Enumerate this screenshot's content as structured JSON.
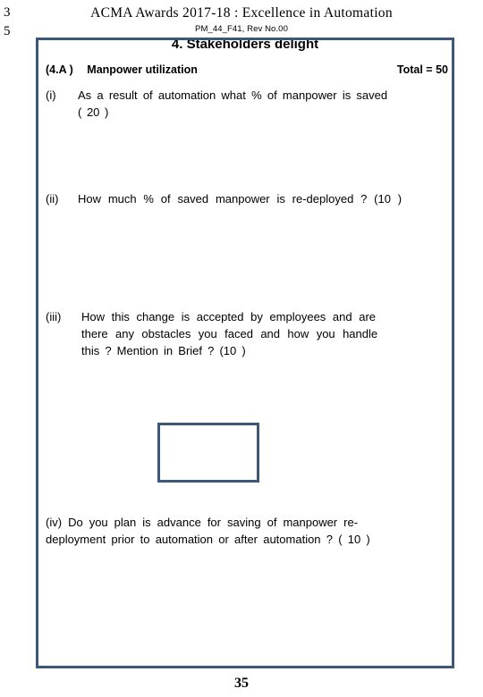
{
  "margin_numbers": [
    "3",
    "5"
  ],
  "header": {
    "title": "ACMA  Awards  2017-18 : Excellence in Automation",
    "subtitle": "PM_44_F41, Rev No.00"
  },
  "section": {
    "title": "4. Stakeholders delight",
    "code": "(4.A )",
    "name": "Manpower utilization",
    "total_label": "Total  = 50"
  },
  "questions": [
    {
      "number": "(i)",
      "lines": [
        "As  a  result  of  automation what % of  manpower  is  saved",
        "( 20  )"
      ]
    },
    {
      "number": "(ii)",
      "lines": [
        "How  much  %  of  saved  manpower is  re-deployed  ? (10 )"
      ]
    },
    {
      "number": "(iii)",
      "lines": [
        "How  this  change  is  accepted  by  employees and are",
        "there  any  obstacles  you  faced  and  how  you  handle",
        "this ? Mention in  Brief     ?  (10 )"
      ]
    },
    {
      "number": "(iv)",
      "lines": [
        "Do you  plan  is  advance for  saving of  manpower  re-",
        "deployment prior  to automation or  after  automation ? ( 10 )"
      ]
    }
  ],
  "answer_box": {
    "label": "answer-box",
    "value": ""
  },
  "footer": {
    "page_number": "35"
  },
  "colors": {
    "frame_border": "#3c5877",
    "text": "#000000",
    "background": "#ffffff"
  }
}
